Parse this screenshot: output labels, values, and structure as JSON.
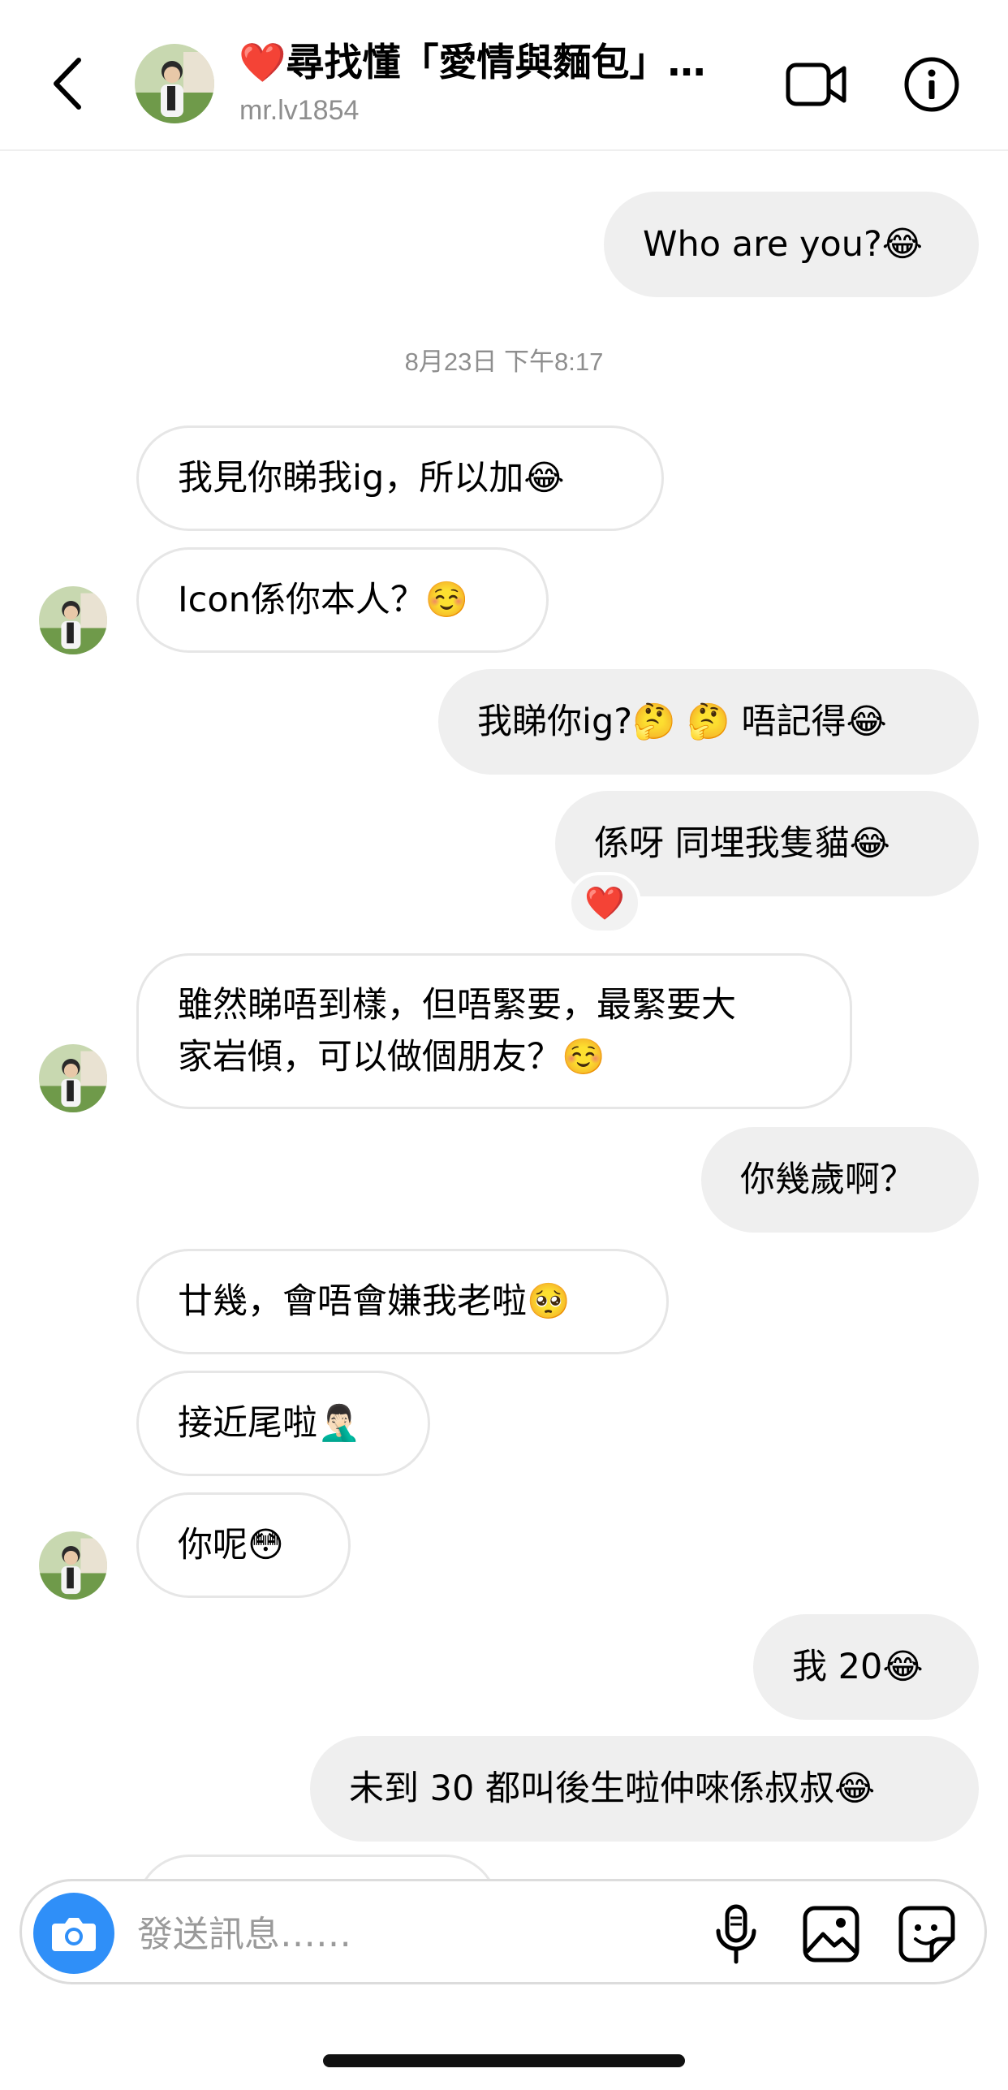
{
  "header": {
    "title": "❤️尋找懂「愛情與麵包」…",
    "username": "mr.lv1854",
    "back_icon": "chevron-left-icon",
    "video_icon": "video-camera-icon",
    "info_icon": "info-icon"
  },
  "messages": [
    {
      "dir": "out",
      "text": "Who are you?😂"
    },
    {
      "dir": "in",
      "text": "我見你睇我ig，所以加😂"
    },
    {
      "dir": "in",
      "text": "Icon係你本人？☺️"
    },
    {
      "dir": "out",
      "text": "我睇你ig?🤔 🤔 唔記得😂"
    },
    {
      "dir": "out",
      "text": "係呀 同埋我隻貓😂",
      "reaction": "❤️"
    },
    {
      "dir": "in",
      "text_line1": "雖然睇唔到樣，但唔緊要，最緊要大",
      "text_line2": "家岩傾，可以做個朋友？☺️"
    },
    {
      "dir": "out",
      "text": "你幾歲啊？"
    },
    {
      "dir": "in",
      "text": "廿幾，會唔會嫌我老啦🥺"
    },
    {
      "dir": "in",
      "text": "接近尾啦🤦🏻‍♂️"
    },
    {
      "dir": "in",
      "text": "你呢😳"
    },
    {
      "dir": "out",
      "text": "我 20😂"
    },
    {
      "dir": "out",
      "text": "未到 30 都叫後生啦仲唻係叔叔😂"
    }
  ],
  "timestamp": "8月23日 下午8:17",
  "composer": {
    "placeholder": "發送訊息……",
    "camera_icon": "camera-icon",
    "mic_icon": "microphone-icon",
    "gallery_icon": "gallery-icon",
    "sticker_icon": "sticker-icon"
  },
  "colors": {
    "outgoing_bubble": "#efefef",
    "incoming_border": "#e6e6e6",
    "camera_button": "#2f8ff8",
    "secondary_text": "#8e8e8e"
  }
}
